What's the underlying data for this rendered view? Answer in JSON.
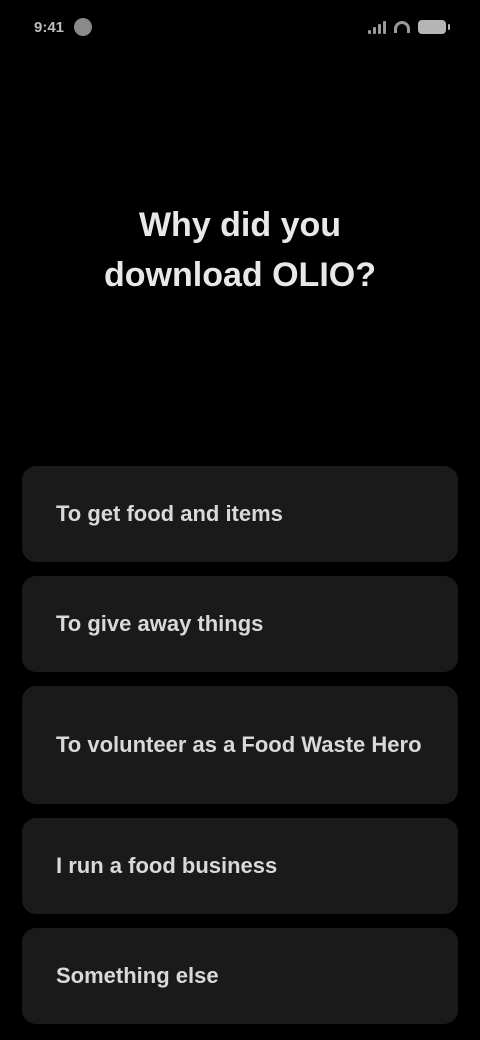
{
  "status_bar": {
    "time": "9:41"
  },
  "page": {
    "title": "Why did you download OLIO?"
  },
  "options": [
    {
      "label": "To get food and items",
      "lines": 1
    },
    {
      "label": "To give away things",
      "lines": 1
    },
    {
      "label": "To volunteer as a Food Waste Hero",
      "lines": 2
    },
    {
      "label": "I run a food business",
      "lines": 1
    },
    {
      "label": "Something else",
      "lines": 1
    }
  ]
}
